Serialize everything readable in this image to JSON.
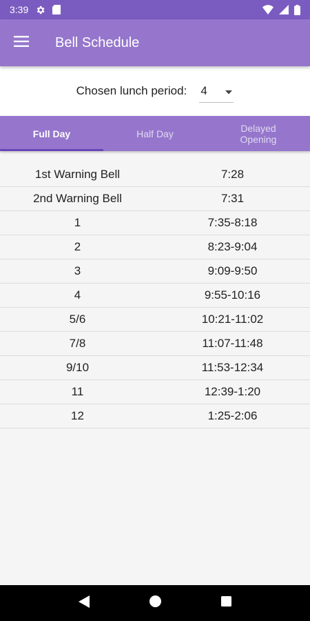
{
  "status_bar": {
    "time": "3:39"
  },
  "app_bar": {
    "title": "Bell Schedule"
  },
  "lunch": {
    "label": "Chosen lunch period:",
    "value": "4"
  },
  "tabs": [
    {
      "label": "Full Day",
      "active": true
    },
    {
      "label": "Half Day",
      "active": false
    },
    {
      "label": "Delayed Opening",
      "active": false
    }
  ],
  "schedule": [
    {
      "period": "1st Warning Bell",
      "time": "7:28"
    },
    {
      "period": "2nd Warning Bell",
      "time": "7:31"
    },
    {
      "period": "1",
      "time": "7:35-8:18"
    },
    {
      "period": "2",
      "time": "8:23-9:04"
    },
    {
      "period": "3",
      "time": "9:09-9:50"
    },
    {
      "period": "4",
      "time": "9:55-10:16"
    },
    {
      "period": "5/6",
      "time": "10:21-11:02"
    },
    {
      "period": "7/8",
      "time": "11:07-11:48"
    },
    {
      "period": "9/10",
      "time": "11:53-12:34"
    },
    {
      "period": "11",
      "time": "12:39-1:20"
    },
    {
      "period": "12",
      "time": "1:25-2:06"
    }
  ],
  "colors": {
    "primary": "#9576cc",
    "primary_dark": "#7a5cc0",
    "tab_indicator": "#6a45b8"
  },
  "icons": [
    "gear-icon",
    "sd-card-icon",
    "wifi-icon",
    "signal-icon",
    "battery-icon",
    "menu-icon",
    "dropdown-arrow-icon",
    "back-icon",
    "home-icon",
    "recents-icon"
  ]
}
